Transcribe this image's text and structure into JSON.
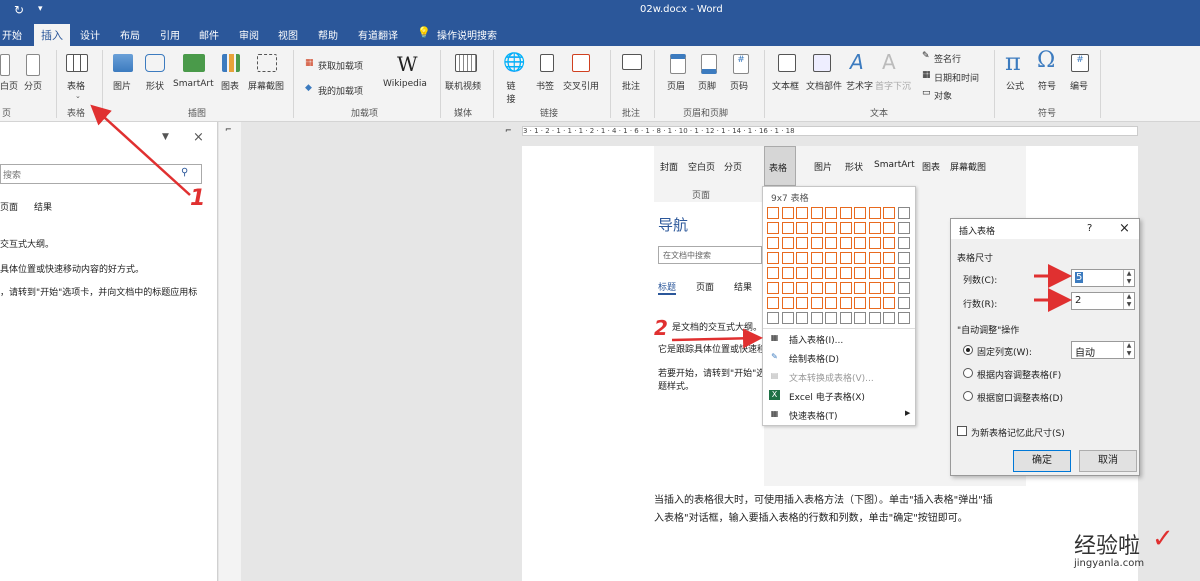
{
  "window": {
    "title": "02w.docx  -  Word"
  },
  "quick_access": {
    "redo_icon": "redo-icon",
    "customize_icon": "chevron-down-icon"
  },
  "tabs": [
    "开始",
    "插入",
    "设计",
    "布局",
    "引用",
    "邮件",
    "审阅",
    "视图",
    "帮助",
    "有道翻译",
    "操作说明搜索"
  ],
  "ribbon": {
    "pages_group": {
      "blank_page": "白页",
      "page_break": "分页",
      "label": "页"
    },
    "table_group": {
      "table": "表格",
      "label": "表格"
    },
    "illustrations": {
      "pictures": "图片",
      "shapes": "形状",
      "smartart": "SmartArt",
      "chart": "图表",
      "screenshot": "屏幕截图",
      "label": "插图"
    },
    "addins": {
      "get": "获取加载项",
      "my": "我的加载项",
      "wikipedia": "Wikipedia",
      "label": "加载项"
    },
    "media": {
      "online_video": "联机视频",
      "label": "媒体"
    },
    "links": {
      "link": "链接",
      "bookmark": "书签",
      "crossref": "交叉引用",
      "label": "链接"
    },
    "comments": {
      "comment": "批注",
      "label": "批注"
    },
    "header_footer": {
      "header": "页眉",
      "footer": "页脚",
      "page_number": "页码",
      "label": "页眉和页脚"
    },
    "text": {
      "textbox": "文本框",
      "quickparts": "文档部件",
      "wordart": "艺术字",
      "dropcap": "首字下沉",
      "signature": "签名行",
      "datetime": "日期和时间",
      "object": "对象",
      "label": "文本"
    },
    "symbols": {
      "equation": "公式",
      "symbol": "符号",
      "number": "编号",
      "label": "符号"
    }
  },
  "nav_pane": {
    "search_placeholder": "搜索",
    "tabs": [
      "页面",
      "结果"
    ],
    "lines": [
      "交互式大纲。",
      "具体位置或快速移动内容的好方式。",
      "，请转到\"开始\"选项卡，并向文档中的标题应用标"
    ]
  },
  "ruler_text": "3 · 1 · 2 · 1 · 1 · 1 · 2 · 1 · 4 · 1 · 6 · 1 · 8 · 1 · 10 · 1 · 12 · 1 · 14 · 1 · 16 · 1 · 18",
  "embedded": {
    "ribbon_items": [
      "封面",
      "空白页",
      "分页",
      "表格",
      "图片",
      "形状",
      "SmartArt",
      "图表",
      "屏幕截图"
    ],
    "group_label": "页面",
    "nav_title": "导航",
    "search_placeholder": "在文档中搜索",
    "tabs": [
      "标题",
      "页面",
      "结果"
    ],
    "lines": [
      "是文档的交互式大纲。",
      "它是跟踪具体位置或快速移",
      "若要开始，请转到\"开始\"选",
      "题样式。"
    ]
  },
  "table_menu": {
    "header": "9x7 表格",
    "grid": {
      "cols": 10,
      "rows": 8,
      "sel_cols": 9,
      "sel_rows": 7
    },
    "items": [
      {
        "label": "插入表格(I)...",
        "icon": "insert-table-icon",
        "disabled": false
      },
      {
        "label": "绘制表格(D)",
        "icon": "pencil-icon",
        "disabled": false
      },
      {
        "label": "文本转换成表格(V)...",
        "icon": "convert-icon",
        "disabled": true
      },
      {
        "label": "Excel 电子表格(X)",
        "icon": "excel-icon",
        "disabled": false
      },
      {
        "label": "快速表格(T)",
        "icon": "quick-table-icon",
        "disabled": false
      }
    ]
  },
  "dialog": {
    "title": "插入表格",
    "help": "?",
    "close": "×",
    "size_label": "表格尺寸",
    "cols_label": "列数(C):",
    "cols_value": "5",
    "rows_label": "行数(R):",
    "rows_value": "2",
    "autofit_label": "\"自动调整\"操作",
    "opt_fixed": "固定列宽(W):",
    "fixed_value": "自动",
    "opt_content": "根据内容调整表格(F)",
    "opt_window": "根据窗口调整表格(D)",
    "remember": "为新表格记忆此尺寸(S)",
    "ok": "确定",
    "cancel": "取消"
  },
  "annotations": {
    "step1": "1",
    "step2": "2",
    "arrow_color": "#e03030"
  },
  "doc_text": [
    "当插入的表格很大时，可使用插入表格方法（下图）。单击\"插入表格\"弹出\"插",
    "入表格\"对话框，输入要插入表格的行数和列数，单击\"确定\"按钮即可。"
  ],
  "watermark": {
    "brand": "经验啦",
    "check": "✓",
    "domain": "jingyanla.com"
  },
  "colors": {
    "accent": "#2b579a",
    "orange": "#e86a1f",
    "red": "#e03030"
  }
}
